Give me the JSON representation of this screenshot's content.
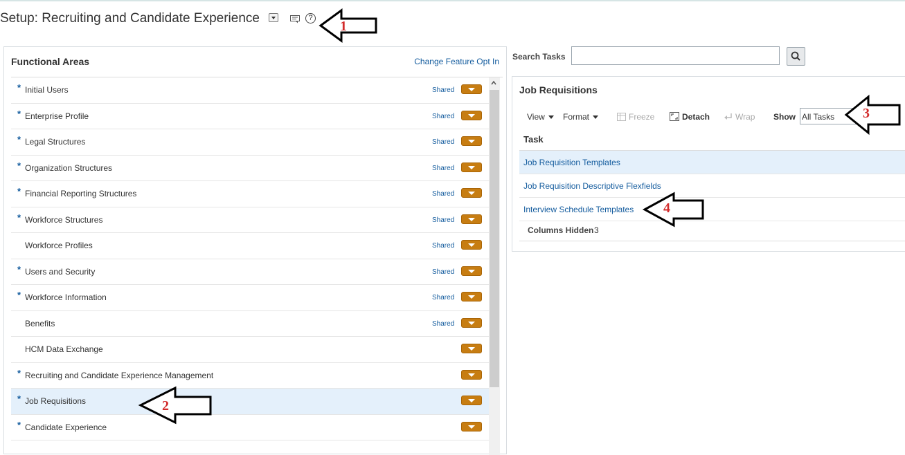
{
  "header": {
    "title": "Setup: Recruiting and Candidate Experience"
  },
  "annotations": [
    "1",
    "2",
    "3",
    "4"
  ],
  "functional_areas": {
    "heading": "Functional Areas",
    "change_link": "Change Feature Opt In",
    "items": [
      {
        "label": "Initial Users",
        "required": true,
        "shared": "Shared"
      },
      {
        "label": "Enterprise Profile",
        "required": true,
        "shared": "Shared"
      },
      {
        "label": "Legal Structures",
        "required": true,
        "shared": "Shared"
      },
      {
        "label": "Organization Structures",
        "required": true,
        "shared": "Shared"
      },
      {
        "label": "Financial Reporting Structures",
        "required": true,
        "shared": "Shared"
      },
      {
        "label": "Workforce Structures",
        "required": true,
        "shared": "Shared"
      },
      {
        "label": "Workforce Profiles",
        "required": false,
        "shared": "Shared"
      },
      {
        "label": "Users and Security",
        "required": true,
        "shared": "Shared"
      },
      {
        "label": "Workforce Information",
        "required": true,
        "shared": "Shared"
      },
      {
        "label": "Benefits",
        "required": false,
        "shared": "Shared"
      },
      {
        "label": "HCM Data Exchange",
        "required": false,
        "shared": ""
      },
      {
        "label": "Recruiting and Candidate Experience Management",
        "required": true,
        "shared": ""
      },
      {
        "label": "Job Requisitions",
        "required": true,
        "shared": "",
        "selected": true
      },
      {
        "label": "Candidate Experience",
        "required": true,
        "shared": ""
      }
    ],
    "required_marker": "*"
  },
  "search": {
    "label": "Search Tasks",
    "value": ""
  },
  "tasks_panel": {
    "title": "Job Requisitions",
    "toolbar": {
      "view": "View",
      "format": "Format",
      "freeze": "Freeze",
      "detach": "Detach",
      "wrap": "Wrap",
      "show_label": "Show",
      "show_value": "All Tasks"
    },
    "column_header": "Task",
    "tasks": [
      {
        "label": "Job Requisition Templates",
        "selected": true
      },
      {
        "label": "Job Requisition Descriptive Flexfields",
        "selected": false
      },
      {
        "label": "Interview Schedule Templates",
        "selected": false
      }
    ],
    "footer": {
      "label": "Columns Hidden",
      "count": "3"
    }
  }
}
